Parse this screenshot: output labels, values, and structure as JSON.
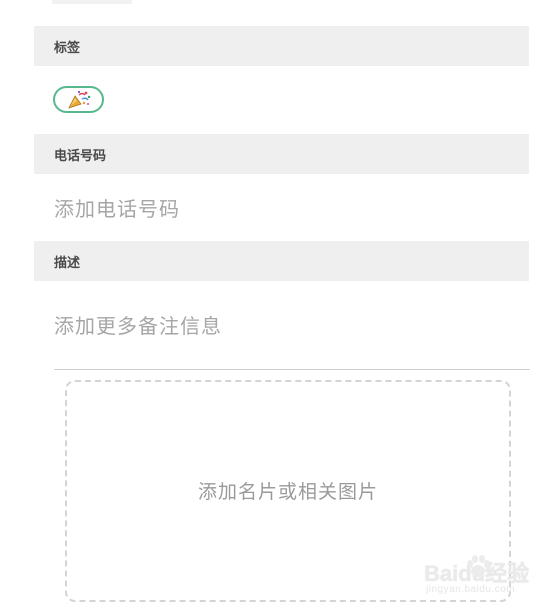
{
  "sections": {
    "tags": {
      "title": "标签"
    },
    "phone": {
      "title": "电话号码",
      "placeholder": "添加电话号码"
    },
    "description": {
      "title": "描述",
      "placeholder": "添加更多备注信息"
    }
  },
  "tag_chip": {
    "icon": "party-popper-icon",
    "accent_color": "#57b88f"
  },
  "image_area": {
    "label": "添加名片或相关图片"
  },
  "watermark": {
    "brand": "Baidu经验",
    "url": "jingyan.baidu.com"
  }
}
